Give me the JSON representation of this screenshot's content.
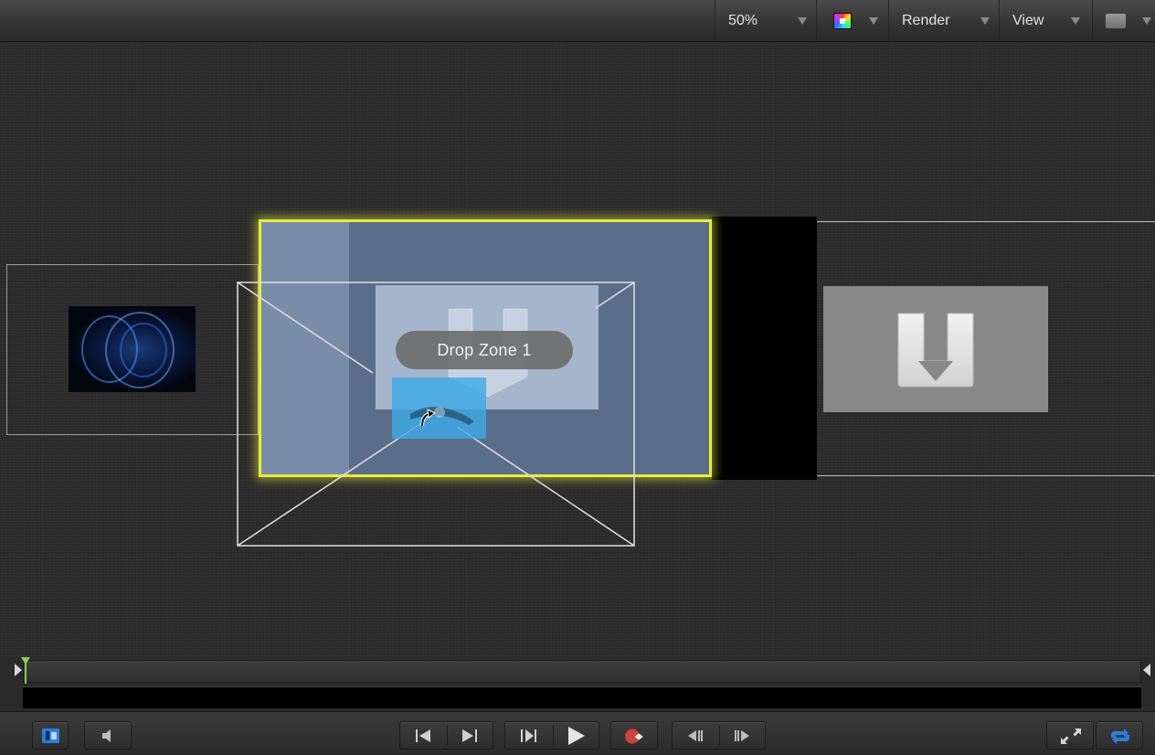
{
  "toolbar": {
    "zoom": "50%",
    "render_label": "Render",
    "view_label": "View"
  },
  "canvas": {
    "drop_zone_tooltip": "Drop Zone 1"
  },
  "colors": {
    "drop_zone_highlight": "#e8ec3c",
    "drop_zone_fill": "#5a6e8a",
    "playhead": "#7fc84a",
    "loop_active": "#2a7ddd",
    "record": "#d04040"
  },
  "transport": {
    "buttons": [
      "show-inspector",
      "audio",
      "go-to-start",
      "go-to-end",
      "play-from-start",
      "play",
      "record",
      "previous-frame",
      "next-frame",
      "full-screen",
      "loop"
    ]
  }
}
